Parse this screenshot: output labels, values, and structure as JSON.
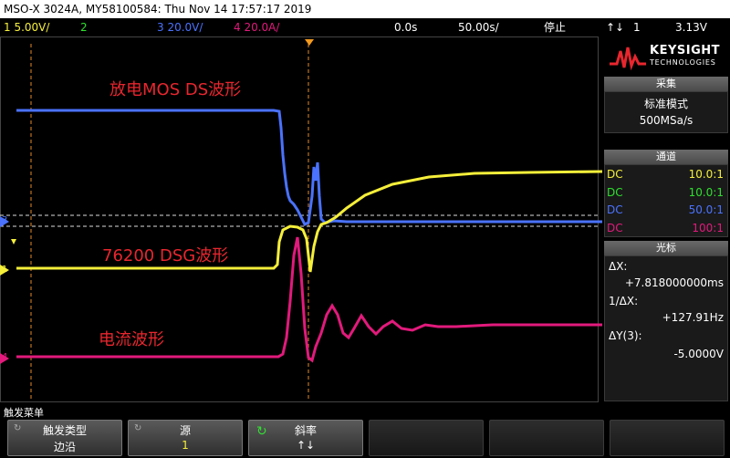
{
  "titlebar": {
    "text": "MSO-X 3024A, MY58100584: Thu Nov 14 17:57:17 2019"
  },
  "status": {
    "ch1": "1  5.00V/",
    "ch2": "2",
    "ch3": "3  20.0V/",
    "ch4": "4  20.0A/",
    "time_delay": "0.0s",
    "time_div": "50.00s/",
    "run_state": "停止",
    "trig_slope": "↑↓",
    "trig_src": "1",
    "trig_level": "3.13V"
  },
  "colors": {
    "ch1": "#f5ef3a",
    "ch2": "#2ee02e",
    "ch3": "#4a72ff",
    "ch4": "#e21a7c",
    "accent_red": "#e8262e"
  },
  "logo": {
    "brand": "KEYSIGHT",
    "sub": "TECHNOLOGIES"
  },
  "acquire": {
    "header": "采集",
    "mode": "标准模式",
    "rate": "500MSa/s"
  },
  "channels": {
    "header": "通道",
    "rows": [
      {
        "coupling": "DC",
        "probe": "10.0:1",
        "color": "#f5ef3a"
      },
      {
        "coupling": "DC",
        "probe": "10.0:1",
        "color": "#2ee02e"
      },
      {
        "coupling": "DC",
        "probe": "50.0:1",
        "color": "#4a72ff"
      },
      {
        "coupling": "DC",
        "probe": "100:1",
        "color": "#e21a7c"
      }
    ]
  },
  "cursors": {
    "header": "光标",
    "dx_label": "ΔX:",
    "dx_value": "+7.818000000ms",
    "inv_label": "1/ΔX:",
    "inv_value": "+127.91Hz",
    "dy_label": "ΔY(3):",
    "dy_value": "-5.0000V"
  },
  "annotations": {
    "mos": "放电MOS DS波形",
    "dsg": "76200 DSG波形",
    "current": "电流波形"
  },
  "markers": {
    "m1": "1",
    "m3": "3",
    "m4": "4"
  },
  "menu": {
    "title": "触发菜单",
    "keys": [
      {
        "label": "触发类型",
        "value": "边沿"
      },
      {
        "label": "源",
        "value": "1"
      },
      {
        "label": "斜率",
        "value": "↑↓"
      }
    ]
  }
}
